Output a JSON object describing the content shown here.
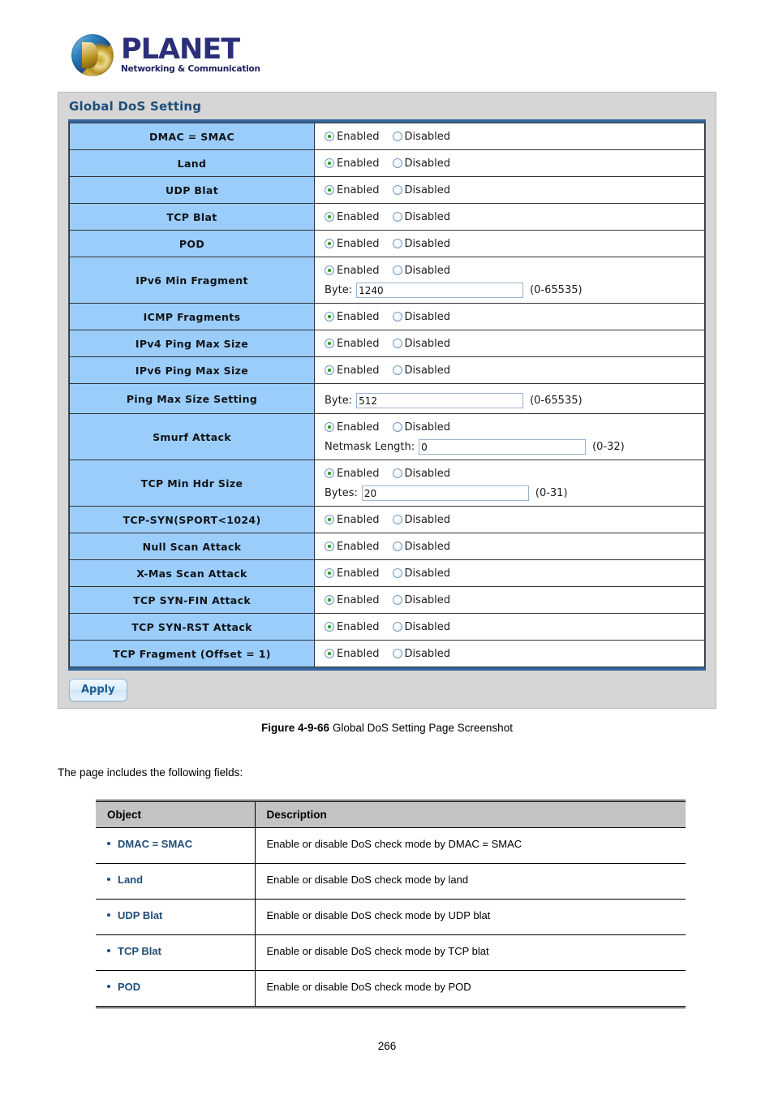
{
  "logo": {
    "brand": "PLANET",
    "tagline": "Networking & Communication"
  },
  "screenshot": {
    "panel_title": "Global DoS Setting",
    "enabled_label": "Enabled",
    "disabled_label": "Disabled",
    "apply_label": "Apply",
    "rows": [
      {
        "label": "DMAC = SMAC",
        "selected": "Enabled"
      },
      {
        "label": "Land",
        "selected": "Enabled"
      },
      {
        "label": "UDP Blat",
        "selected": "Enabled"
      },
      {
        "label": "TCP Blat",
        "selected": "Enabled"
      },
      {
        "label": "POD",
        "selected": "Enabled"
      },
      {
        "label": "IPv6 Min Fragment",
        "selected": "Enabled",
        "field_label": "Byte:",
        "field_value": "1240",
        "field_hint": "(0-65535)"
      },
      {
        "label": "ICMP Fragments",
        "selected": "Enabled"
      },
      {
        "label": "IPv4 Ping Max Size",
        "selected": "Enabled"
      },
      {
        "label": "IPv6 Ping Max Size",
        "selected": "Enabled"
      },
      {
        "label": "Ping Max Size Setting",
        "selected": null,
        "field_label": "Byte:",
        "field_value": "512",
        "field_hint": "(0-65535)"
      },
      {
        "label": "Smurf Attack",
        "selected": "Enabled",
        "field_label": "Netmask Length:",
        "field_value": "0",
        "field_hint": "(0-32)"
      },
      {
        "label": "TCP Min Hdr Size",
        "selected": "Enabled",
        "field_label": "Bytes:",
        "field_value": "20",
        "field_hint": "(0-31)"
      },
      {
        "label": "TCP-SYN(SPORT<1024)",
        "selected": "Enabled"
      },
      {
        "label": "Null Scan Attack",
        "selected": "Enabled"
      },
      {
        "label": "X-Mas Scan Attack",
        "selected": "Enabled"
      },
      {
        "label": "TCP SYN-FIN Attack",
        "selected": "Enabled"
      },
      {
        "label": "TCP SYN-RST Attack",
        "selected": "Enabled"
      },
      {
        "label": "TCP Fragment (Offset = 1)",
        "selected": "Enabled"
      }
    ]
  },
  "figure": {
    "number": "Figure 4-9-66",
    "caption": " Global DoS Setting Page Screenshot"
  },
  "intro_text": "The page includes the following fields:",
  "desc_table": {
    "headers": [
      "Object",
      "Description"
    ],
    "rows": [
      {
        "object": "DMAC = SMAC",
        "description": "Enable or disable DoS check mode by DMAC = SMAC"
      },
      {
        "object": "Land",
        "description": "Enable or disable DoS check mode by land"
      },
      {
        "object": "UDP Blat",
        "description": "Enable or disable DoS check mode by UDP blat"
      },
      {
        "object": "TCP Blat",
        "description": "Enable or disable DoS check mode by TCP blat"
      },
      {
        "object": "POD",
        "description": "Enable or disable DoS check mode by POD"
      }
    ]
  },
  "page_number": "266",
  "colors": {
    "label_cell": "#9bcdfb",
    "panel_bg": "#d6d6d6",
    "accent_blue": "#1f4e79",
    "radio_dot": "#1f9e1f",
    "desc_header": "#c3c3c3"
  }
}
